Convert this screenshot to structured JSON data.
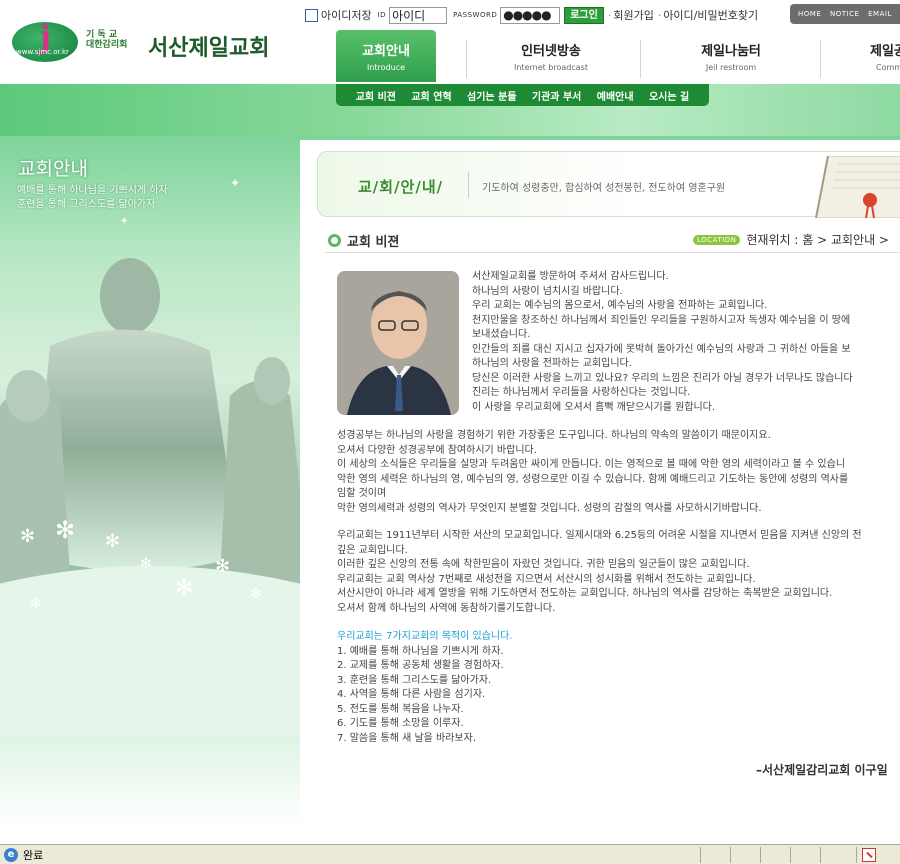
{
  "logo": {
    "mark_text": "j",
    "mark_ring": "www.sjmc.or.kr",
    "denomination_line1": "기 독 교",
    "denomination_line2": "대한감리회",
    "church_name": "서산제일교회"
  },
  "login": {
    "save_id_label": "아이디저장",
    "id_tag": "ID",
    "id_value": "아이디",
    "password_tag": "PASSWORD",
    "password_value": "●●●●●",
    "login_button": "로그인",
    "join_link": "회원가입",
    "find_link": "아이디/비밀번호찾기"
  },
  "top_menu": [
    "HOME",
    "NOTICE",
    "EMAIL"
  ],
  "gnb": [
    {
      "ko": "교회안내",
      "en": "Introduce",
      "active": true
    },
    {
      "ko": "인터넷방송",
      "en": "Internet broadcast",
      "active": false
    },
    {
      "ko": "제일나눔터",
      "en": "Jeil restroom",
      "active": false
    },
    {
      "ko": "제일공",
      "en": "Comm",
      "active": false
    }
  ],
  "submenu": [
    "교회 비젼",
    "교회 연혁",
    "섬기는 분들",
    "기관과 부서",
    "예배안내",
    "오시는 길"
  ],
  "side": {
    "title": "교회안내",
    "line1": "예배를 통해 하나님을 기쁘시게 하자",
    "line2": "훈련을 통해 그리스도를 닮아가자"
  },
  "banner": {
    "label": "교/회/안/내/",
    "description": "기도하여 성령충만, 합심하여 성전봉헌, 전도하여 영혼구원"
  },
  "section": {
    "title": "교회 비젼",
    "location_badge": "LOCATION",
    "location_path": "현재위치 : 홈 > 교회안내 >"
  },
  "intro_lines": [
    "서산제일교회를 방문하여 주셔서 감사드립니다.",
    "하나님의 사랑이 넘치시길 바랍니다.",
    "우리 교회는 예수님의 몸으로서, 예수님의 사랑을 전파하는 교회입니다.",
    "천지만물을 창조하신 하나님께서 죄인들인 우리들을 구원하시고자 독생자 예수님을 이 땅에",
    "보내셨습니다.",
    "인간들의 죄를 대신 지시고 십자가에 못박혀 돌아가신 예수님의 사랑과 그 귀하신 아들을 보",
    "하나님의 사랑을 전파하는 교회입니다.",
    "당신은 이러한 사랑을 느끼고 있나요? 우리의 느낌은 진리가 아닐 경우가 너무나도 많습니다",
    "진리는 하나님께서 우리들을 사랑하신다는 것입니다.",
    "이 사랑을 우리교회에 오셔서 흠뻑 깨닫으시기를 원합니다."
  ],
  "para1_lines": [
    "성경공부는 하나님의 사랑을 경험하기 위한 가장좋은 도구입니다. 하나님의 약속의 말씀이기 때문이지요.",
    "오셔서 다양한 성경공부에 참여하시기 바랍니다.",
    "이 세상의 소식들은 우리들을 실망과 두려움만 싸이게 만듭니다. 이는 영적으로 볼 때에 악한 영의 세력이라고 볼 수 있습니",
    "악한 영의 세력은 하나님의 영, 예수님의 영, 성령으로만 이길 수 있습니다. 함께 예배드리고 기도하는 동안에 성령의 역사를",
    "임할 것이며",
    "악한 영의세력과 성령의 역사가 무엇인지 분별할 것입니다. 성령의 감절의 역사를 사모하시기바랍니다."
  ],
  "para2_lines": [
    "우리교회는 1911년부터 시작한 서산의 모교회입니다. 일제시대와 6.25등의 어려운 시절을 지나면서 믿음을 지켜낸 신앙의 전",
    "깊은 교회입니다.",
    "이러한 깊은 신앙의 전통 속에 착한믿음이 자랐던 것입니다. 귀한 믿음의 일군들이 많은 교회입니다.",
    "우리교회는 교회 역사상 7번째로 새성전을 지으면서 서산시의 성시화를 위해서 전도하는 교회입니다.",
    "서산시만이 아니라 세계 열방을 위해 기도하면서 전도하는 교회입니다. 하나님의 역사를 감당하는 축복받은 교회입니다.",
    "오셔서 함께 하나님의 사역에 동참하기를기도합니다."
  ],
  "purpose": {
    "heading": "우리교회는 7가지교회의 목적이 있습니다.",
    "items": [
      "1. 예배를 통해 하나님을 기쁘시게 하자.",
      "2. 교제를 통해 공동체 생활을 경험하자.",
      "3. 훈련을 통해 그리스도를 닮아가자.",
      "4. 사역을 통해 다른 사람을 섬기자.",
      "5. 전도를 통해 복음을 나누자.",
      "6. 기도를 통해 소망을 이루자.",
      "7. 말씀을 통해 새 날을 바라보자."
    ]
  },
  "signature": "–서산제일감리교회 이구일",
  "status_bar": {
    "message": "완료"
  },
  "colors": {
    "brand_green": "#2f9f4c",
    "submenu_green": "#1f8a34",
    "purpose_blue": "#1a9ed6",
    "location_badge": "#8cc63f"
  }
}
